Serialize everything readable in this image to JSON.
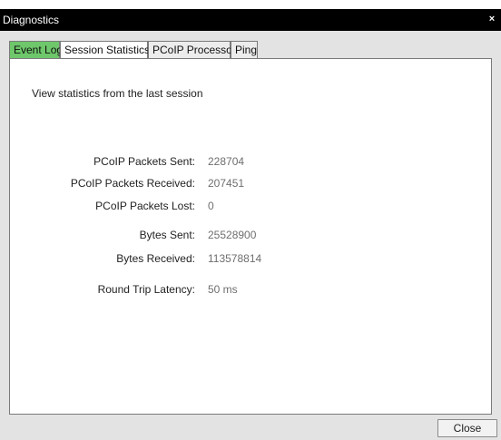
{
  "window": {
    "title": "Diagnostics",
    "close_glyph": "×"
  },
  "tabs": [
    {
      "label": "Event Log",
      "state": "highlighted"
    },
    {
      "label": "Session Statistics",
      "state": "selected"
    },
    {
      "label": "PCoIP Processor",
      "state": "normal"
    },
    {
      "label": "Ping",
      "state": "normal"
    }
  ],
  "panel": {
    "intro": "View statistics from the last session",
    "stats": [
      {
        "label": "PCoIP Packets Sent:",
        "value": "228704"
      },
      {
        "label": "PCoIP Packets Received:",
        "value": "207451"
      },
      {
        "label": "PCoIP Packets Lost:",
        "value": "0"
      },
      {
        "label": "Bytes Sent:",
        "value": "25528900"
      },
      {
        "label": "Bytes Received:",
        "value": "113578814"
      },
      {
        "label": "Round Trip Latency:",
        "value": "50 ms"
      }
    ]
  },
  "footer": {
    "close_label": "Close"
  },
  "colors": {
    "active_tab": "#6ec76a",
    "titlebar": "#000000",
    "value_text": "#6e6e6e"
  }
}
